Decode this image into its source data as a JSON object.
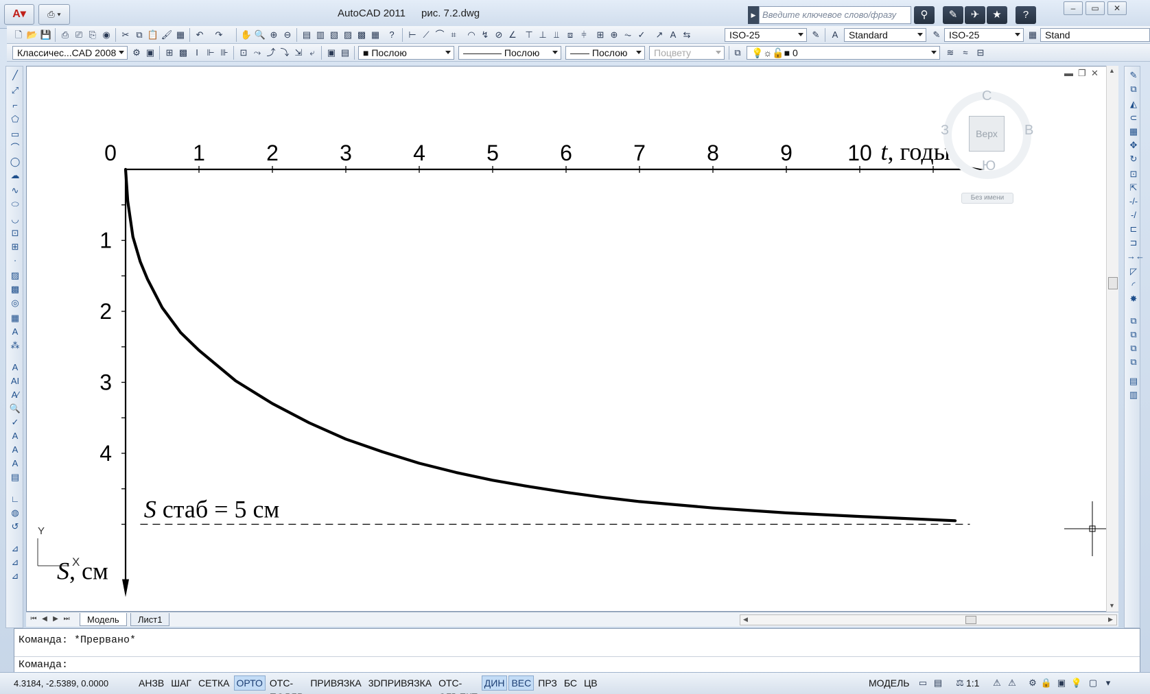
{
  "window": {
    "app_name": "AutoCAD 2011",
    "file_name": "рис. 7.2.dwg",
    "search_placeholder": "Введите ключевое слово/фразу"
  },
  "toolbar1": {
    "dim_style": "ISO-25",
    "text_style": "Standard",
    "multileader_style": "ISO-25",
    "table_style": "Stand"
  },
  "toolbar2": {
    "workspace": "Классичес...CAD 2008",
    "color": "Послою",
    "linetype": "Послою",
    "lineweight": "Послою",
    "plot_style": "Поцвету",
    "layer": "0"
  },
  "viewcube": {
    "north": "С",
    "south": "Ю",
    "west": "З",
    "east": "В",
    "face": "Верх",
    "ucs_name": "Без имени"
  },
  "ucs_icon": {
    "x_label": "X",
    "y_label": "Y"
  },
  "chart_data": {
    "type": "line",
    "x_tick_labels": [
      "0",
      "1",
      "2",
      "3",
      "4",
      "5",
      "6",
      "7",
      "8",
      "9",
      "10"
    ],
    "y_tick_labels": [
      "1",
      "2",
      "3",
      "4"
    ],
    "xlabel_var": "t",
    "xlabel_unit": ", годы",
    "ylabel_var": "S",
    "ylabel_unit": ", см",
    "xlim": [
      0,
      11.5
    ],
    "ylim": [
      0,
      5.6
    ],
    "y_inverted": true,
    "x_axis_position": "top",
    "series": [
      {
        "x": [
          0,
          0.03,
          0.1,
          0.2,
          0.3,
          0.5,
          0.75,
          1,
          1.5,
          2,
          2.5,
          3,
          3.5,
          4,
          4.5,
          5,
          5.5,
          6,
          6.5,
          7,
          8,
          9,
          10,
          11.3
        ],
        "y": [
          0,
          0.45,
          0.95,
          1.3,
          1.55,
          1.95,
          2.3,
          2.55,
          2.98,
          3.3,
          3.57,
          3.8,
          3.98,
          4.14,
          4.27,
          4.38,
          4.47,
          4.55,
          4.62,
          4.68,
          4.77,
          4.84,
          4.89,
          4.95
        ]
      }
    ],
    "asymptote": {
      "y": 5,
      "var": "S",
      "label": " стаб = 5 см",
      "style": "dashed"
    }
  },
  "tabs": [
    "Модель",
    "Лист1"
  ],
  "command_line": {
    "history": "Команда: *Прервано*",
    "prompt": "Команда:"
  },
  "status_bar": {
    "coordinates": "4.3184,  -2.5389, 0.0000",
    "toggles": [
      {
        "label": "АНЗВ",
        "on": false
      },
      {
        "label": "ШАГ",
        "on": false
      },
      {
        "label": "СЕТКА",
        "on": false
      },
      {
        "label": "ОРТО",
        "on": true
      },
      {
        "label": "ОТС-ПОЛЯР",
        "on": false
      },
      {
        "label": "ПРИВЯЗКА",
        "on": false
      },
      {
        "label": "3DПРИВЯЗКА",
        "on": false
      },
      {
        "label": "ОТС-ОБЪЕКТ",
        "on": false
      },
      {
        "label": "ДИН",
        "on": true
      },
      {
        "label": "ВЕС",
        "on": true
      },
      {
        "label": "ПРЗ",
        "on": false
      },
      {
        "label": "БС",
        "on": false
      },
      {
        "label": "ЦВ",
        "on": false
      }
    ],
    "space": "МОДЕЛЬ",
    "annotation_scale": "1:1"
  }
}
